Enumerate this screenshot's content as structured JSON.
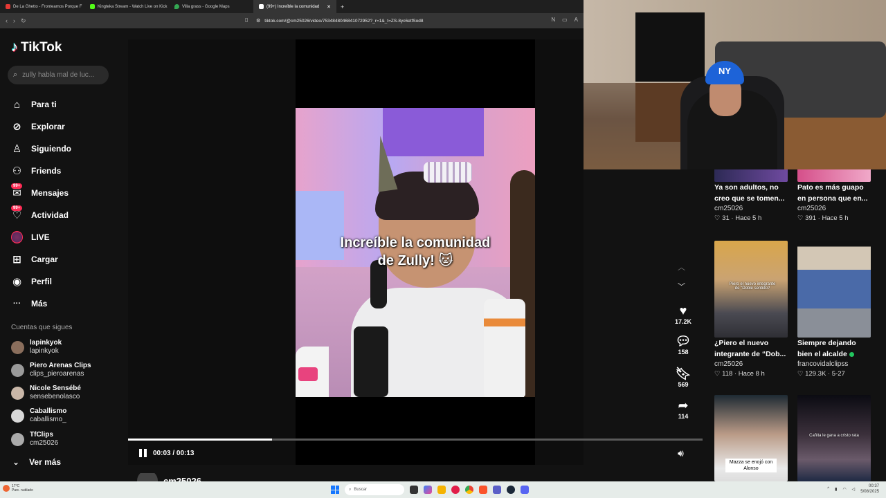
{
  "browser": {
    "tabs": [
      {
        "title": "De La Ghetto - Fronteamos Porque F",
        "color": "#e53935"
      },
      {
        "title": "Kingteka Stream - Watch Live on Kick",
        "color": "#53fc18"
      },
      {
        "title": "Villa grass - Google Maps",
        "color": "#34a853"
      },
      {
        "title": "(99+) Increíble la comunidad",
        "color": "#ffffff"
      }
    ],
    "url": "tiktok.com/@cm25026/video/7534848046841072952?_r=1&_t=ZS-8yc6etfSod8"
  },
  "sidebar": {
    "logo": "TikTok",
    "search_placeholder": "zully habla mal de luc...",
    "menu": [
      {
        "label": "Para ti",
        "icon": "home-icon",
        "glyph": "⌂"
      },
      {
        "label": "Explorar",
        "icon": "compass-icon",
        "glyph": "⊘"
      },
      {
        "label": "Siguiendo",
        "icon": "following-icon",
        "glyph": "♙"
      },
      {
        "label": "Friends",
        "icon": "friends-icon",
        "glyph": "⚇"
      },
      {
        "label": "Mensajes",
        "icon": "messages-icon",
        "glyph": "✉",
        "badge": "99+"
      },
      {
        "label": "Actividad",
        "icon": "activity-icon",
        "glyph": "♡",
        "badge": "99+"
      },
      {
        "label": "LIVE",
        "icon": "live-icon",
        "glyph": ""
      },
      {
        "label": "Cargar",
        "icon": "upload-icon",
        "glyph": "⊞"
      },
      {
        "label": "Perfil",
        "icon": "profile-icon",
        "glyph": "◉"
      },
      {
        "label": "Más",
        "icon": "more-icon",
        "glyph": "···"
      }
    ],
    "following_header": "Cuentas que sigues",
    "accounts": [
      {
        "name": "lapinkyok",
        "handle": "lapinkyok"
      },
      {
        "name": "Piero Arenas Clips",
        "handle": "clips_pieroarenas"
      },
      {
        "name": "Nicole Sensébé",
        "handle": "sensebenolasco"
      },
      {
        "name": "Caballismo",
        "handle": "caballismo_"
      },
      {
        "name": "TfClips",
        "handle": "cm25026"
      }
    ],
    "see_more": "Ver más"
  },
  "video": {
    "caption_line1": "Increíble la comunidad",
    "caption_line2": "de Zully! 🐱",
    "time": "00:03 / 00:13",
    "progress": 0.25,
    "author": "cm25026"
  },
  "actions": {
    "likes": "17.2K",
    "comments": "158",
    "saves": "569",
    "shares": "114"
  },
  "recommended": [
    {
      "title": "Ya son adultos, no creo que se tomen...",
      "author": "cm25026",
      "likes": "31",
      "time": "Hace 5 h"
    },
    {
      "title": "Pato es más guapo en persona que en...",
      "author": "cm25026",
      "likes": "391",
      "time": "Hace 5 h"
    },
    {
      "title": "¿Piero el nuevo integrante de “Dob...",
      "author": "cm25026",
      "likes": "118",
      "time": "Hace 8 h",
      "overlay": "Piero el nuevo integrante de \"Doble sentido?"
    },
    {
      "title": "Siempre dejando bien el alcalde",
      "author": "francovidalclipss",
      "likes": "129.3K",
      "time": "5-27"
    },
    {
      "title": "",
      "author": "",
      "likes": "",
      "time": "",
      "overlay": "Mazza se enojó con Alonso"
    },
    {
      "title": "",
      "author": "",
      "likes": "",
      "time": "",
      "overlay": "Cañita le gana a cristo rata"
    }
  ],
  "taskbar": {
    "weather_temp": "17°C",
    "weather_desc": "Parc. nublado",
    "search": "Buscar",
    "time": "00:37",
    "date": "5/08/2025"
  }
}
